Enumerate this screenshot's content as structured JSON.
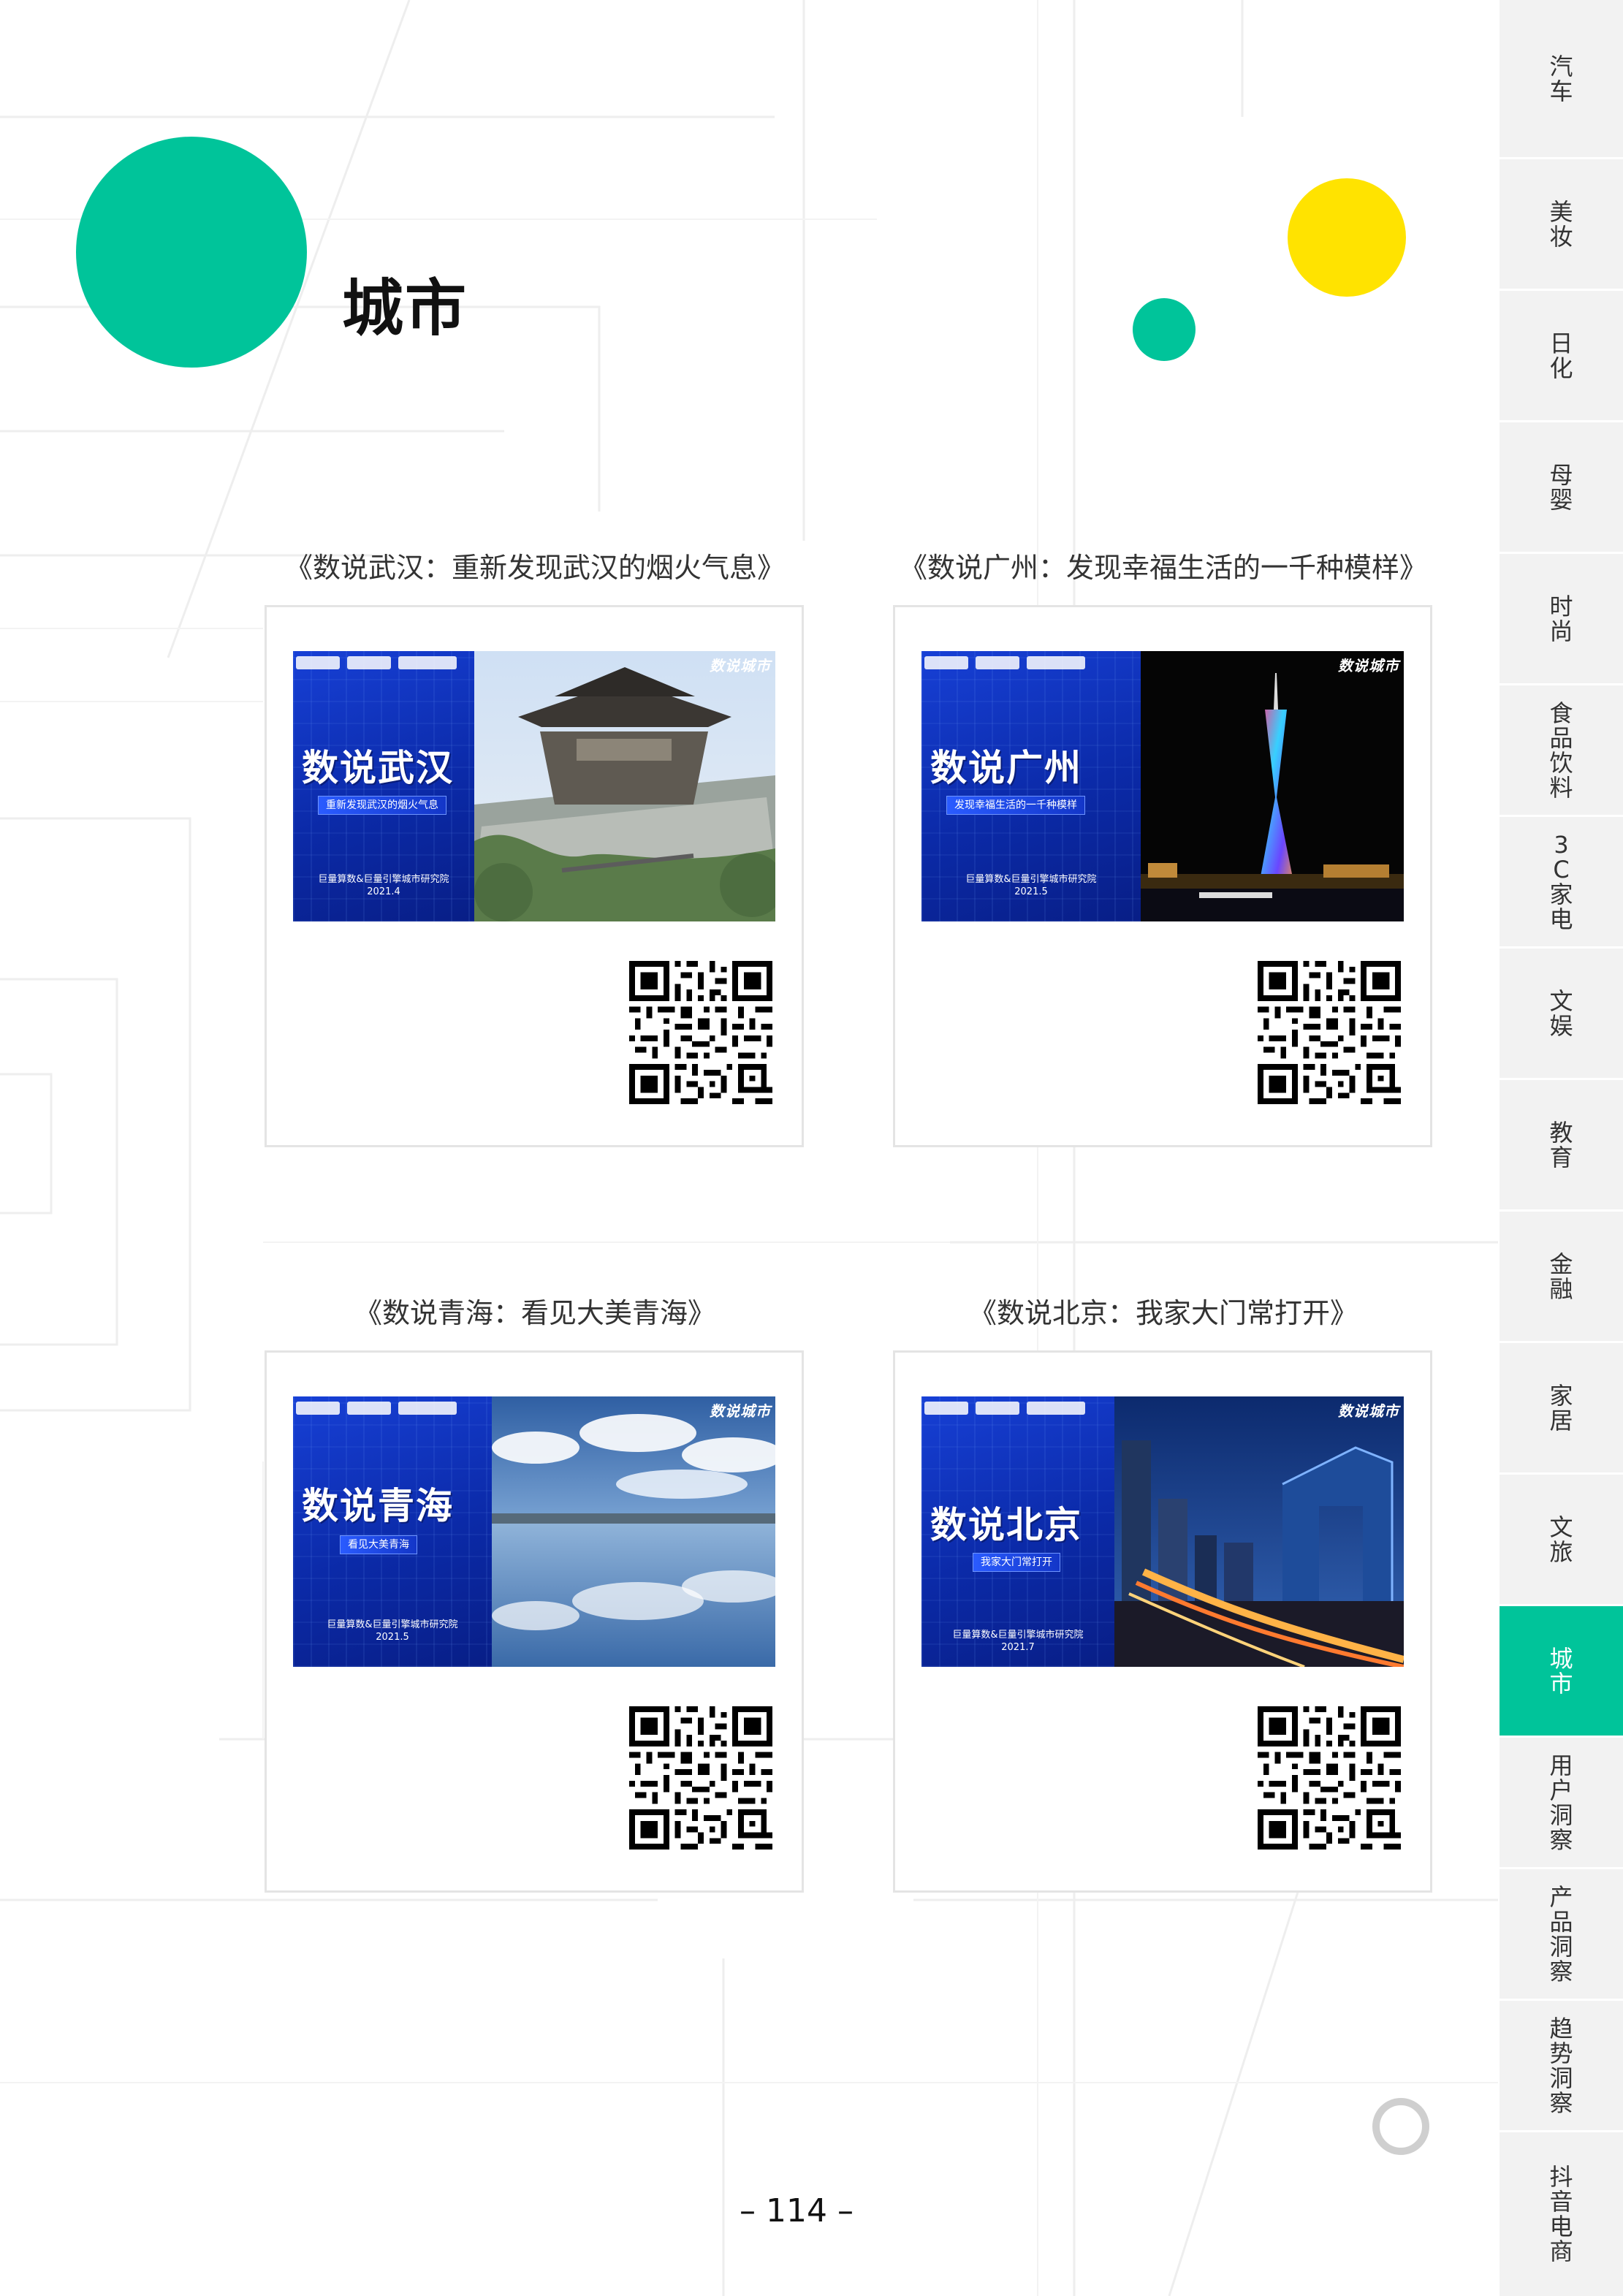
{
  "page_title": "城市",
  "page_number": "– 114 –",
  "sidebar": {
    "active": "城市",
    "items": [
      "汽车",
      "美妆",
      "日化",
      "母婴",
      "时尚",
      "食品饮料",
      "3C家电",
      "文娱",
      "教育",
      "金融",
      "家居",
      "文旅",
      "城市",
      "用户洞察",
      "产品洞察",
      "趋势洞察",
      "抖音电商"
    ]
  },
  "reports": [
    {
      "title": "《数说武汉：重新发现武汉的烟火气息》",
      "cover": {
        "headline": "数说武汉",
        "subtitle": "重新发现武汉的烟火气息",
        "org": "巨量算数&巨量引擎城市研究院",
        "date": "2021.4",
        "tag": "数说城市"
      }
    },
    {
      "title": "《数说广州：发现幸福生活的一千种模样》",
      "cover": {
        "headline": "数说广州",
        "subtitle": "发现幸福生活的一千种模样",
        "org": "巨量算数&巨量引擎城市研究院",
        "date": "2021.5",
        "tag": "数说城市"
      }
    },
    {
      "title": "《数说青海：看见大美青海》",
      "cover": {
        "headline": "数说青海",
        "subtitle": "看见大美青海",
        "org": "巨量算数&巨量引擎城市研究院",
        "date": "2021.5",
        "tag": "数说城市"
      }
    },
    {
      "title": "《数说北京：我家大门常打开》",
      "cover": {
        "headline": "数说北京",
        "subtitle": "我家大门常打开",
        "org": "巨量算数&巨量引擎城市研究院",
        "date": "2021.7",
        "tag": "数说城市"
      }
    }
  ],
  "colors": {
    "accent_green": "#00c49a",
    "accent_yellow": "#ffe300",
    "cover_blue": "#0b2aa8"
  }
}
